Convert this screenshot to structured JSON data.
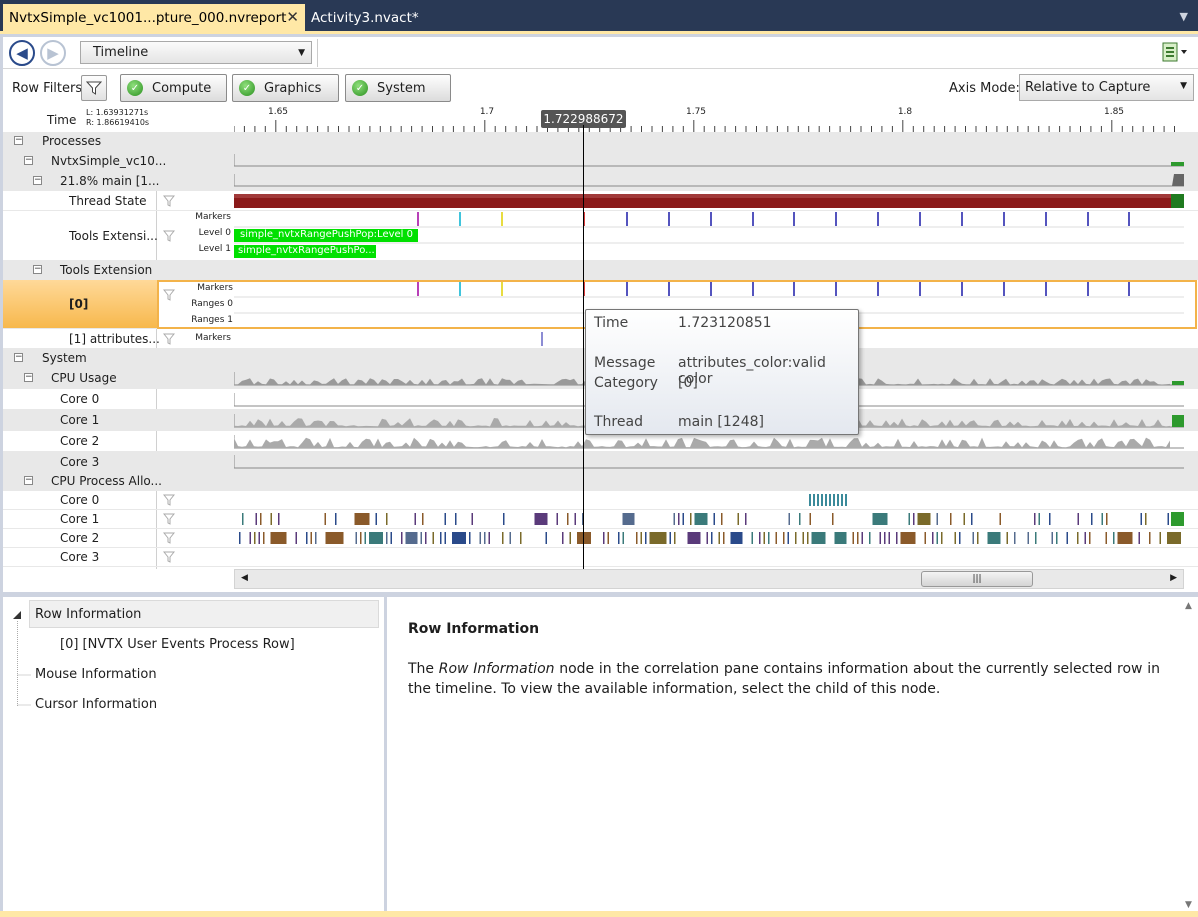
{
  "tabs": {
    "active": "NvtxSimple_vc1001...pture_000.nvreport",
    "inactive": "Activity3.nvact*"
  },
  "toolbar": {
    "back_icon": "back-arrow-icon",
    "forward_icon": "forward-arrow-icon",
    "view_select": "Timeline"
  },
  "filters": {
    "label": "Row Filters",
    "buttons": [
      "Compute",
      "Graphics",
      "System"
    ],
    "axis_mode_label": "Axis Mode:",
    "axis_mode_value": "Relative to Capture"
  },
  "ruler": {
    "label": "Time",
    "left": "L: 1.63931271s",
    "right": "R: 1.86619410s",
    "ticks": [
      "1.65",
      "1.7",
      "1.75",
      "1.8",
      "1.85"
    ],
    "cursor": "1.722988672"
  },
  "rows": {
    "processes": "Processes",
    "process_name": "NvtxSimple_vc10...",
    "thread": "21.8% main [1...",
    "thread_state": "Thread State",
    "tools_ext_short": "Tools Extensi...",
    "markers": "Markers",
    "level0": "Level 0",
    "level1": "Level 1",
    "range_level0": "simple_nvtxRangePushPop:Level 0",
    "range_level1": "simple_nvtxRangePushPo...",
    "tools_extension": "Tools Extension",
    "sel_row": "[0]",
    "ranges0": "Ranges 0",
    "ranges1": "Ranges 1",
    "attr_row": "[1] attributes...",
    "system": "System",
    "cpu_usage": "CPU Usage",
    "cpu_alloc": "CPU Process Allo...",
    "cores": [
      "Core 0",
      "Core 1",
      "Core 2",
      "Core 3"
    ]
  },
  "tooltip": {
    "time_k": "Time",
    "time_v": "1.723120851",
    "msg_k": "Message",
    "msg_v": "attributes_color:valid color",
    "cat_k": "Category",
    "cat_v": "[0]",
    "thread_k": "Thread",
    "thread_v": "main [1248]"
  },
  "tree": {
    "root": "Row Information",
    "child": "[0] [NVTX User Events Process Row]",
    "mouse": "Mouse Information",
    "cursor": "Cursor Information"
  },
  "help": {
    "title": "Row Information",
    "text_pre": "The ",
    "text_em": "Row Information",
    "text_post": " node in the correlation pane contains information about the currently selected row in the timeline. To view the available information, select the child of this node."
  },
  "colors": {
    "tab_bar": "#293955",
    "tab_active": "#ffe8a6",
    "thread_state": "#8b1a1a",
    "range_green": "#00e000",
    "selection": "#f7b84c"
  }
}
